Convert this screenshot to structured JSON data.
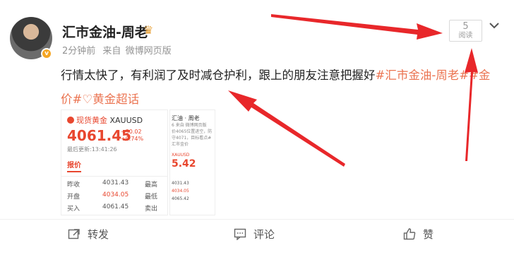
{
  "post": {
    "author": "汇市金油-周老",
    "crown_icon": "crown-icon",
    "verified_badge": "v",
    "time": "2分钟前",
    "source_prefix": "来自",
    "source": "微博网页版",
    "read_count": "5",
    "read_label": "阅读",
    "text_main": "行情太快了，有利润了及时减仓护利，跟上的朋友注意把握好",
    "tag1": "#汇市金油-周老#",
    "tag2": "#金价#",
    "tag3_icon": "supertopic-icon",
    "tag3": "黄金超话"
  },
  "thumbnail": {
    "market_name": "现货黄金",
    "symbol": "XAUUSD",
    "price": "4061.45",
    "change": "+30.02",
    "change_pct": "+0.74%",
    "updated": "最后更新:13:41:26",
    "tab": "报价",
    "rows": [
      {
        "k": "昨收",
        "v": "4031.43",
        "k2": "最高"
      },
      {
        "k": "开盘",
        "v": "4034.05",
        "k2": "最低"
      },
      {
        "k": "买入",
        "v": "4061.45",
        "k2": "卖出"
      }
    ]
  },
  "thumbnail2": {
    "author_short": "汇油 · 周老",
    "time_short": "6 来自 微博网页版",
    "text_short": "价4065位置进空，防守4071，目标看点#汇市金价",
    "symbol_short": "XAUUSD",
    "price_short": "5.42",
    "rows": [
      "4031.43",
      "4034.05",
      "4065.42"
    ]
  },
  "actions": {
    "repost": "转发",
    "comment": "评论",
    "like": "赞"
  },
  "colors": {
    "accent_orange": "#eb7350",
    "price_red": "#e8472f",
    "annotation_red": "#e8272a"
  }
}
